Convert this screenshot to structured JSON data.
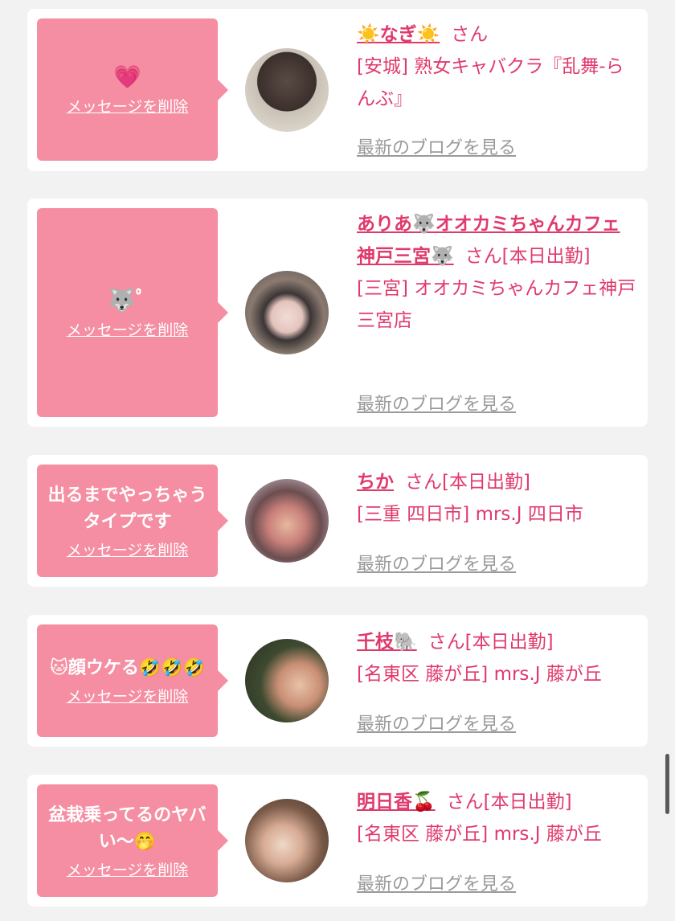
{
  "delete_label": "メッセージを削除",
  "san_label": "さん",
  "blog_label": "最新のブログを見る",
  "cards": [
    {
      "message": "💗",
      "name": "☀️なぎ☀️",
      "status": "",
      "shop": "[安城] 熟女キャバクラ『乱舞-らんぶ』"
    },
    {
      "message": "🐺ﾟ",
      "name": "ありあ🐺オオカミちゃんカフェ神戸三宮🐺",
      "status": "[本日出勤]",
      "shop": "[三宮] オオカミちゃんカフェ神戸三宮店"
    },
    {
      "message": "出るまでやっちゃうタイプです",
      "name": "ちか",
      "status": "[本日出勤]",
      "shop": "[三重 四日市] mrs.J 四日市"
    },
    {
      "message": "🐱顔ウケる🤣🤣🤣",
      "name": "千枝🐘",
      "status": "[本日出勤]",
      "shop": "[名東区 藤が丘] mrs.J 藤が丘"
    },
    {
      "message": "盆栽乗ってるのヤバい〜🤭",
      "name": "明日香🍒",
      "status": "[本日出勤]",
      "shop": "[名東区 藤が丘] mrs.J 藤が丘"
    }
  ]
}
